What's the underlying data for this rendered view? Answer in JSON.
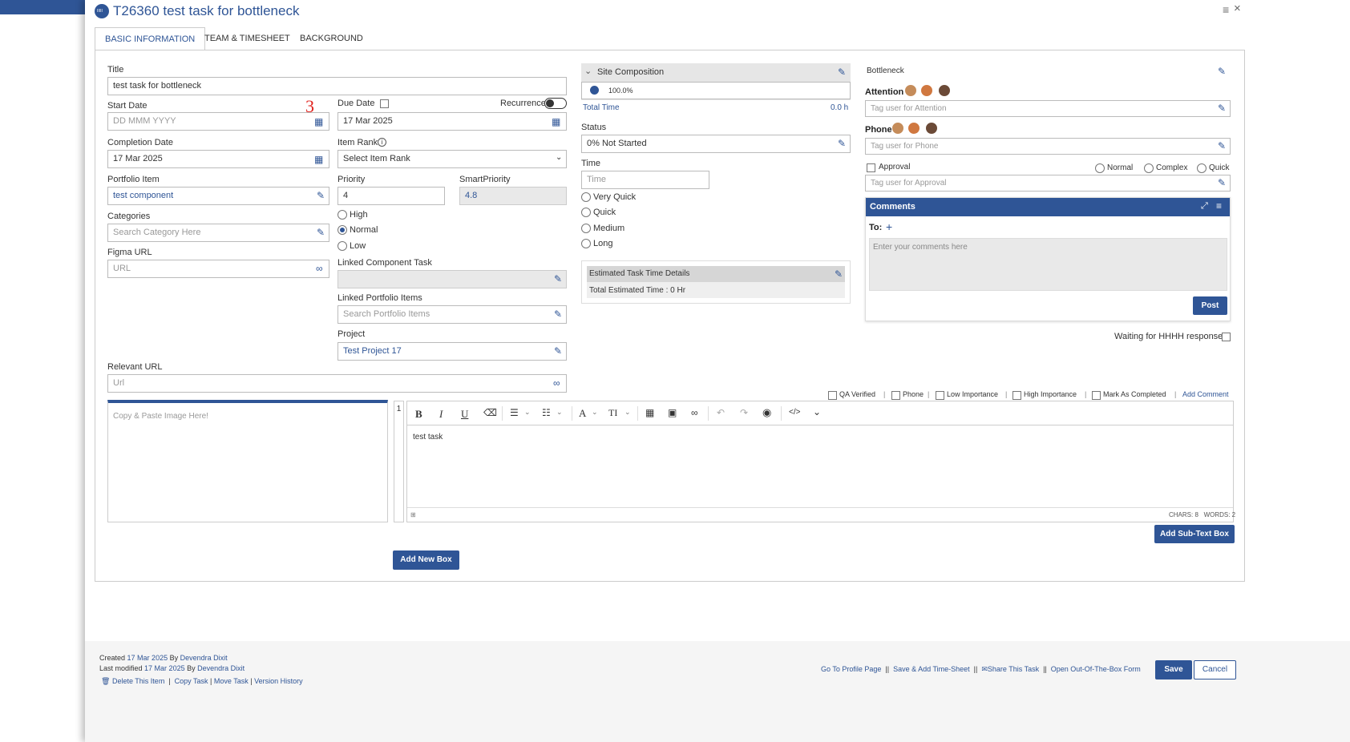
{
  "header": {
    "task_id_title": "T26360 test task for bottleneck"
  },
  "tabs": [
    "BASIC INFORMATION",
    "TEAM & TIMESHEET",
    "BACKGROUND"
  ],
  "form": {
    "title_label": "Title",
    "title_value": "test task for bottleneck",
    "start_date_label": "Start Date",
    "start_date_placeholder": "DD MMM YYYY",
    "annotation_number": "3",
    "due_date_label": "Due Date",
    "due_date_value": "17 Mar 2025",
    "recurrence_label": "Recurrence",
    "completion_date_label": "Completion Date",
    "completion_date_value": "17 Mar 2025",
    "item_rank_label": "Item Rank",
    "item_rank_value": "Select Item Rank",
    "portfolio_item_label": "Portfolio Item",
    "portfolio_item_value": "test component",
    "priority_label": "Priority",
    "priority_value": "4",
    "smart_priority_label": "SmartPriority",
    "smart_priority_value": "4.8",
    "priority_options": [
      "High",
      "Normal",
      "Low"
    ],
    "categories_label": "Categories",
    "categories_placeholder": "Search Category Here",
    "figma_url_label": "Figma URL",
    "figma_url_placeholder": "URL",
    "linked_component_label": "Linked Component Task",
    "linked_portfolio_label": "Linked Portfolio Items",
    "linked_portfolio_placeholder": "Search Portfolio Items",
    "project_label": "Project",
    "project_value": "Test Project 17",
    "relevant_url_label": "Relevant URL",
    "relevant_url_placeholder": "Url"
  },
  "site": {
    "header": "Site Composition",
    "percent": "100.0%",
    "total_time_label": "Total Time",
    "total_time_value": "0.0 h",
    "status_label": "Status",
    "status_value": "0% Not Started",
    "time_label": "Time",
    "time_placeholder": "Time",
    "time_options": [
      "Very Quick",
      "Quick",
      "Medium",
      "Long"
    ],
    "estimate_header": "Estimated Task Time Details",
    "estimate_total": "Total Estimated Time :  0 Hr"
  },
  "right": {
    "bottleneck_label": "Bottleneck",
    "attention_label": "Attention",
    "attention_placeholder": "Tag user for Attention",
    "phone_label": "Phone",
    "phone_placeholder": "Tag user for Phone",
    "approval_label": "Approval",
    "approval_options": [
      "Normal",
      "Complex",
      "Quick"
    ],
    "approval_placeholder": "Tag user for Approval",
    "comments_title": "Comments",
    "to_label": "To:",
    "comment_placeholder": "Enter your comments here",
    "post_label": "Post",
    "waiting_label": "Waiting for HHHH response"
  },
  "flags": [
    "QA Verified",
    "Phone",
    "Low Importance",
    "High Importance",
    "Mark As Completed"
  ],
  "add_comment_label": "Add Comment",
  "editor": {
    "paste_placeholder": "Copy & Paste Image Here!",
    "box_number": "1",
    "content": "test task",
    "stats": "CHARS: 8   WORDS: 2",
    "add_subtext_label": "Add Sub-Text Box",
    "add_new_box_label": "Add New Box"
  },
  "footer": {
    "created_prefix": "Created",
    "created_date": "17 Mar 2025",
    "created_by_word": "By",
    "created_by": "Devendra Dixit",
    "modified_prefix": "Last modified",
    "modified_date": "17 Mar 2025",
    "modified_by_word": "By",
    "modified_by": "Devendra Dixit",
    "actions": [
      "Delete This Item",
      "Copy Task",
      "Move Task",
      "Version History"
    ],
    "links": [
      "Go To Profile Page",
      "Save & Add Time-Sheet",
      "Share This Task",
      "Open Out-Of-The-Box Form"
    ],
    "save_label": "Save",
    "cancel_label": "Cancel"
  },
  "colors": {
    "brand": "#2f5596",
    "annotation": "#e0221d"
  }
}
